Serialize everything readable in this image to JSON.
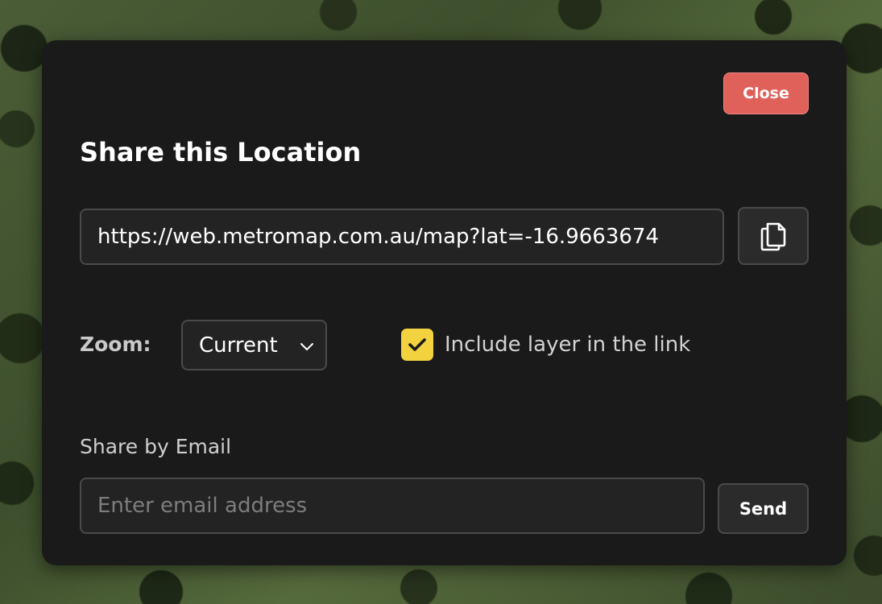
{
  "dialog": {
    "title": "Share this Location",
    "close_label": "Close",
    "share_url": "https://web.metromap.com.au/map?lat=-16.9663674"
  },
  "options": {
    "zoom_label": "Zoom:",
    "zoom_value": "Current",
    "include_layer_label": "Include layer in the link",
    "include_layer_checked": true
  },
  "email": {
    "section_label": "Share by Email",
    "placeholder": "Enter email address",
    "value": "",
    "send_label": "Send"
  },
  "icons": {
    "copy": "copy-icon",
    "chevron": "chevron-down-icon",
    "check": "check-icon"
  },
  "colors": {
    "close_button": "#e0605a",
    "checkbox": "#f2d23e",
    "dialog_bg": "#1a1a1a"
  }
}
